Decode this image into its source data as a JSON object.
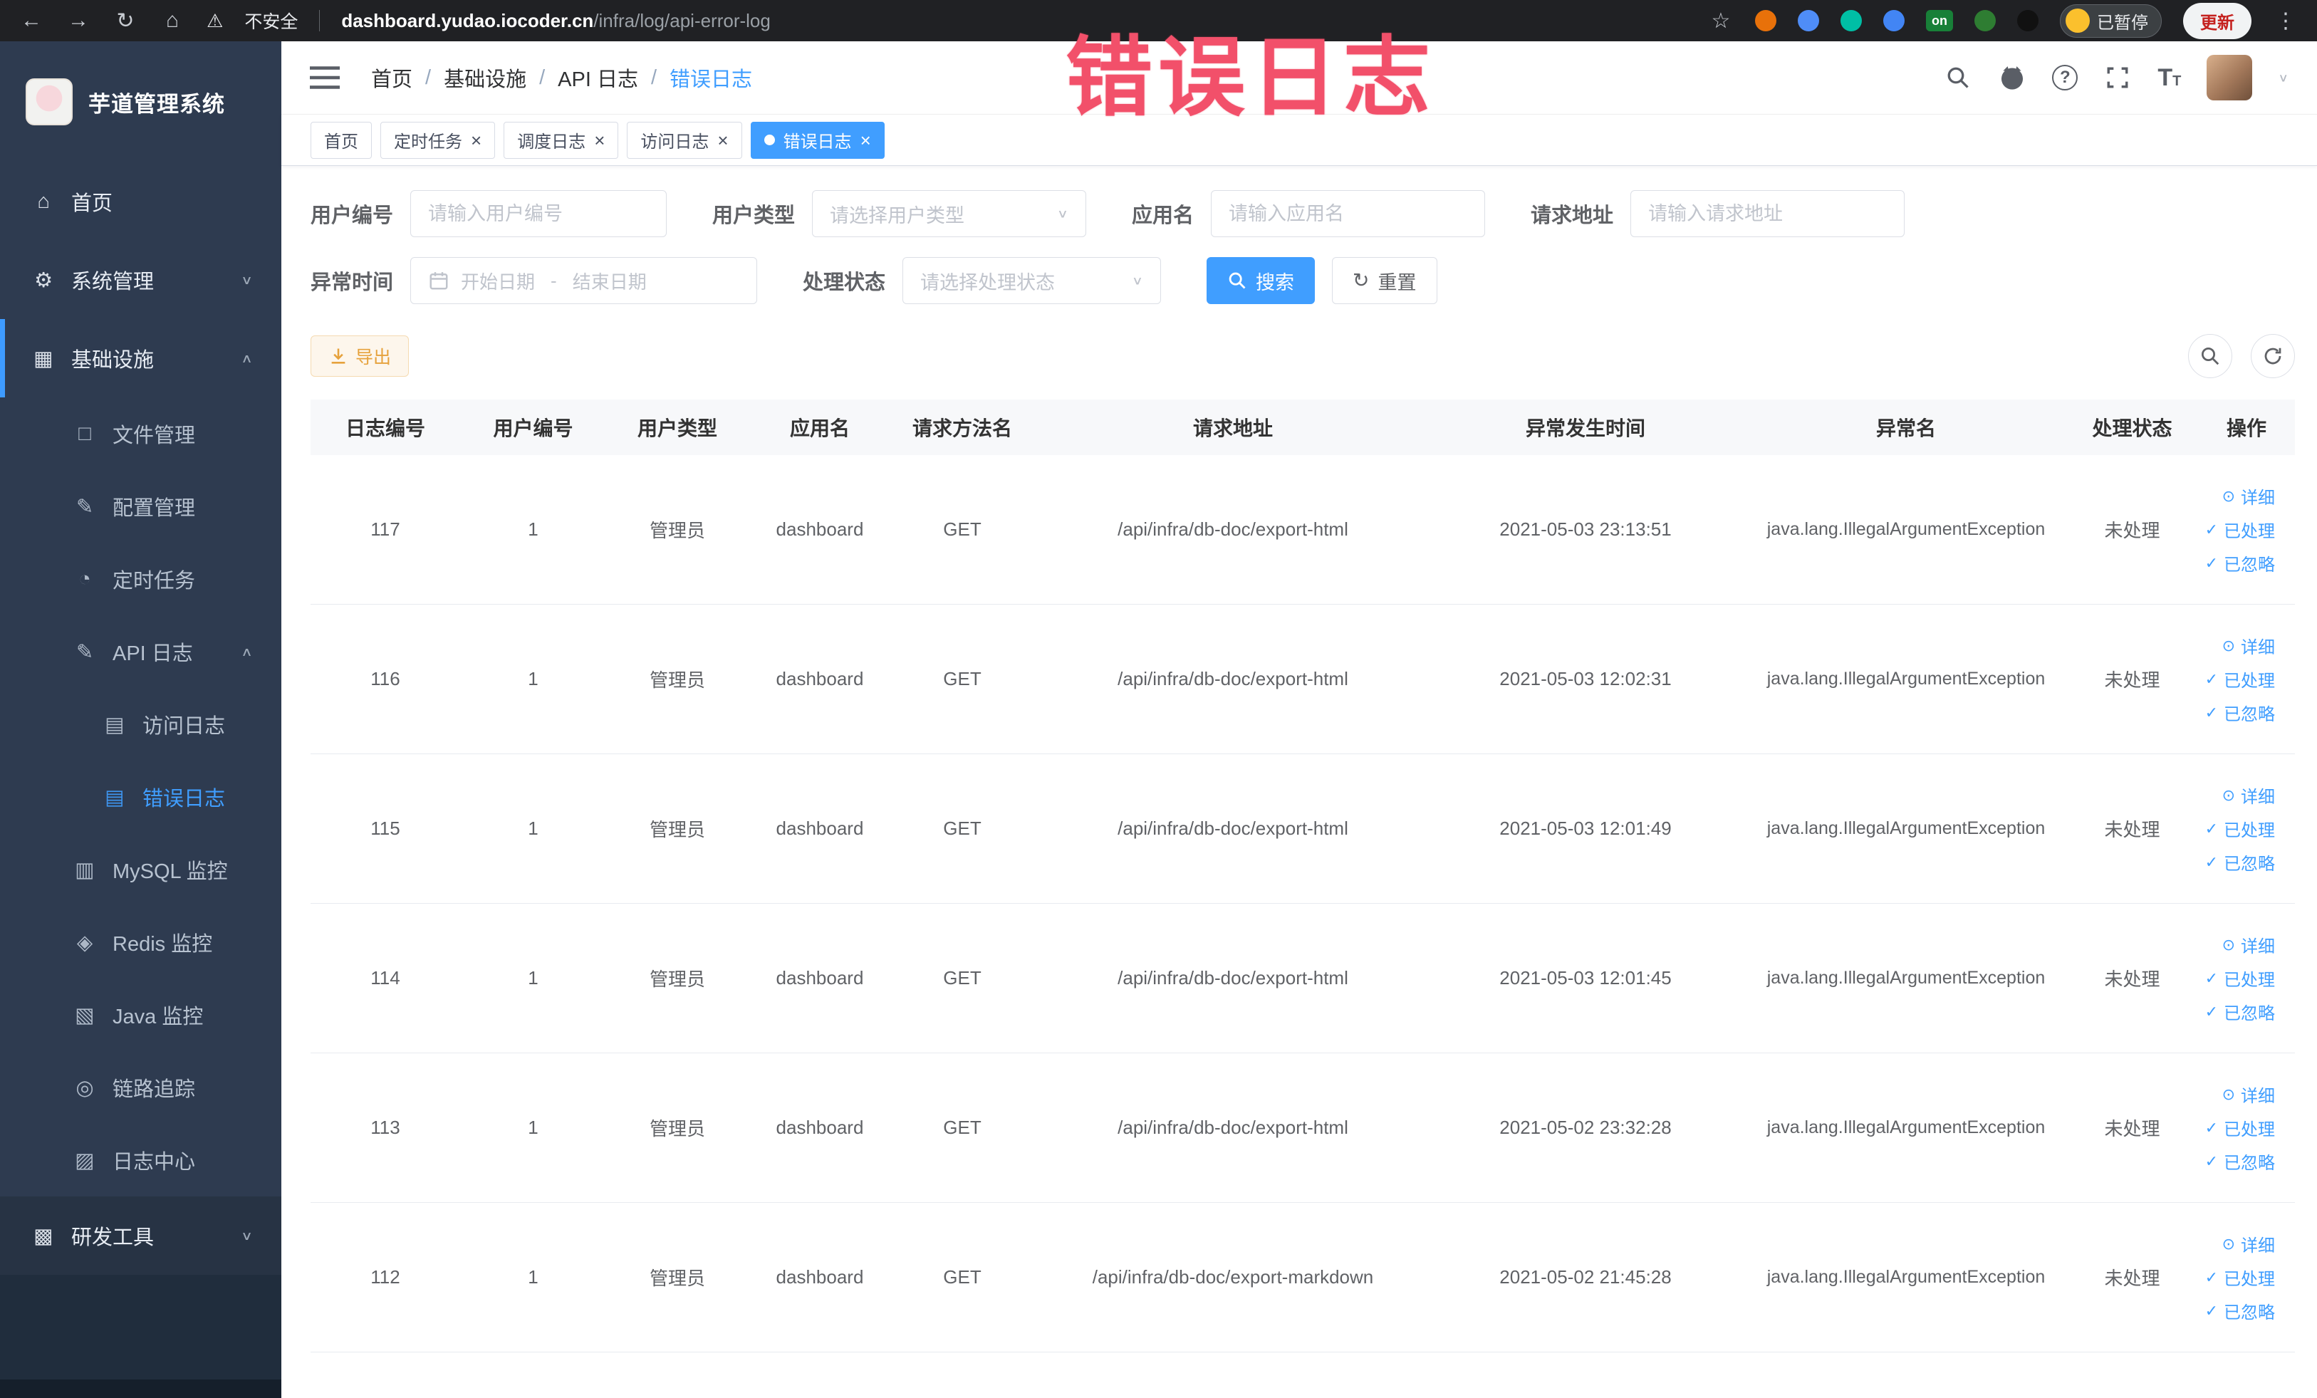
{
  "browser": {
    "icons": {
      "back": "←",
      "forward": "→",
      "reload": "↻",
      "home": "⌂",
      "warning": "⚠",
      "star": "☆",
      "kebab": "⋮"
    },
    "security_label": "不安全",
    "url_domain": "dashboard.yudao.iocoder.cn",
    "url_path": "/infra/log/api-error-log",
    "ext_on_label": "on",
    "paused_label": "已暂停",
    "update_label": "更新"
  },
  "annotation": {
    "text": "错误日志",
    "color": "#f2506a"
  },
  "sidebar": {
    "logo_title": "芋道管理系统",
    "items": [
      {
        "name": "home",
        "label": "首页",
        "level": "top",
        "icon": "⌂"
      },
      {
        "name": "system",
        "label": "系统管理",
        "level": "top",
        "icon": "⚙",
        "chevron": "∨"
      },
      {
        "name": "infra",
        "label": "基础设施",
        "level": "top",
        "icon": "▦",
        "chevron": "∧",
        "accent": true
      },
      {
        "name": "file",
        "label": "文件管理",
        "level": "sub",
        "icon": "□"
      },
      {
        "name": "config",
        "label": "配置管理",
        "level": "sub",
        "icon": "✎"
      },
      {
        "name": "job",
        "label": "定时任务",
        "level": "sub",
        "icon": "◔"
      },
      {
        "name": "api-log",
        "label": "API 日志",
        "level": "sub",
        "icon": "✎",
        "chevron": "∧"
      },
      {
        "name": "access-log",
        "label": "访问日志",
        "level": "subsub",
        "icon": "▤"
      },
      {
        "name": "error-log",
        "label": "错误日志",
        "level": "subsub",
        "icon": "▤",
        "active": true
      },
      {
        "name": "mysql",
        "label": "MySQL 监控",
        "level": "sub",
        "icon": "▥"
      },
      {
        "name": "redis",
        "label": "Redis 监控",
        "level": "sub",
        "icon": "◈"
      },
      {
        "name": "java",
        "label": "Java 监控",
        "level": "sub",
        "icon": "▧"
      },
      {
        "name": "trace",
        "label": "链路追踪",
        "level": "sub",
        "icon": "◎"
      },
      {
        "name": "log-center",
        "label": "日志中心",
        "level": "sub",
        "icon": "▨"
      },
      {
        "name": "dev-tools",
        "label": "研发工具",
        "level": "top",
        "icon": "▩",
        "chevron": "∨",
        "dark": true
      }
    ]
  },
  "header": {
    "breadcrumbs": [
      {
        "label": "首页",
        "sep": "/"
      },
      {
        "label": "基础设施",
        "sep": "/"
      },
      {
        "label": "API 日志",
        "sep": "/"
      },
      {
        "label": "错误日志",
        "current": true
      }
    ]
  },
  "tabs": {
    "close_glyph": "×",
    "items": [
      {
        "label": "首页"
      },
      {
        "label": "定时任务",
        "closable": true
      },
      {
        "label": "调度日志",
        "closable": true
      },
      {
        "label": "访问日志",
        "closable": true
      },
      {
        "label": "错误日志",
        "closable": true,
        "active": true
      }
    ]
  },
  "filters": {
    "user_id": {
      "label": "用户编号",
      "placeholder": "请输入用户编号"
    },
    "user_type": {
      "label": "用户类型",
      "placeholder": "请选择用户类型"
    },
    "app_name": {
      "label": "应用名",
      "placeholder": "请输入应用名"
    },
    "request_url": {
      "label": "请求地址",
      "placeholder": "请输入请求地址"
    },
    "exception_time": {
      "label": "异常时间",
      "start_placeholder": "开始日期",
      "separator": "-",
      "end_placeholder": "结束日期"
    },
    "process_status": {
      "label": "处理状态",
      "placeholder": "请选择处理状态"
    },
    "search_button": "搜索",
    "reset_button": "重置"
  },
  "toolbar": {
    "export_button": "导出"
  },
  "table": {
    "columns": [
      "日志编号",
      "用户编号",
      "用户类型",
      "应用名",
      "请求方法名",
      "请求地址",
      "异常发生时间",
      "异常名",
      "处理状态",
      "操作"
    ],
    "action_icons": {
      "detail": "⊙",
      "processed": "✓",
      "ignored": "✓"
    },
    "action_labels": {
      "detail": "详细",
      "processed": "已处理",
      "ignored": "已忽略"
    },
    "rows": [
      {
        "id": "117",
        "user_id": "1",
        "user_type": "管理员",
        "app": "dashboard",
        "method": "GET",
        "url": "/api/infra/db-doc/export-html",
        "time": "2021-05-03 23:13:51",
        "exception": "java.lang.IllegalArgumentException",
        "status": "未处理"
      },
      {
        "id": "116",
        "user_id": "1",
        "user_type": "管理员",
        "app": "dashboard",
        "method": "GET",
        "url": "/api/infra/db-doc/export-html",
        "time": "2021-05-03 12:02:31",
        "exception": "java.lang.IllegalArgumentException",
        "status": "未处理"
      },
      {
        "id": "115",
        "user_id": "1",
        "user_type": "管理员",
        "app": "dashboard",
        "method": "GET",
        "url": "/api/infra/db-doc/export-html",
        "time": "2021-05-03 12:01:49",
        "exception": "java.lang.IllegalArgumentException",
        "status": "未处理"
      },
      {
        "id": "114",
        "user_id": "1",
        "user_type": "管理员",
        "app": "dashboard",
        "method": "GET",
        "url": "/api/infra/db-doc/export-html",
        "time": "2021-05-03 12:01:45",
        "exception": "java.lang.IllegalArgumentException",
        "status": "未处理"
      },
      {
        "id": "113",
        "user_id": "1",
        "user_type": "管理员",
        "app": "dashboard",
        "method": "GET",
        "url": "/api/infra/db-doc/export-html",
        "time": "2021-05-02 23:32:28",
        "exception": "java.lang.IllegalArgumentException",
        "status": "未处理"
      },
      {
        "id": "112",
        "user_id": "1",
        "user_type": "管理员",
        "app": "dashboard",
        "method": "GET",
        "url": "/api/infra/db-doc/export-markdown",
        "time": "2021-05-02 21:45:28",
        "exception": "java.lang.IllegalArgumentException",
        "status": "未处理"
      }
    ]
  }
}
